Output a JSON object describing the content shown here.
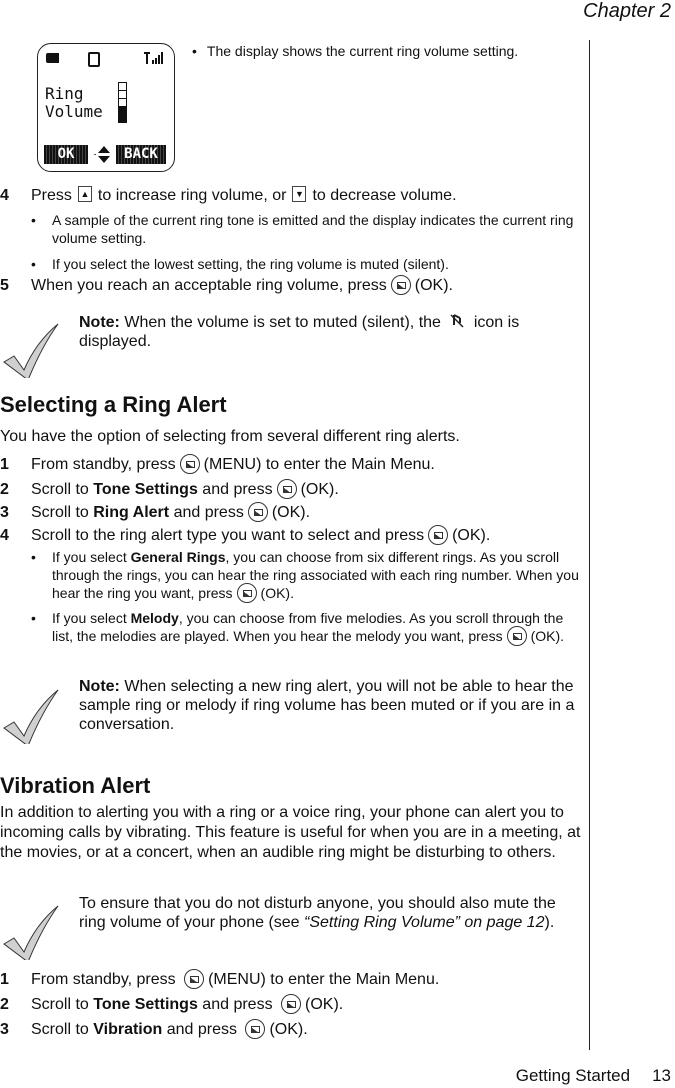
{
  "header": {
    "chapter": "Chapter 2"
  },
  "footer": {
    "section": "Getting Started",
    "page": "13"
  },
  "phone_display": {
    "label_line1": "Ring",
    "label_line2": "Volume",
    "volume_level": 2,
    "volume_max": 5,
    "softkey_left": "OK",
    "softkey_right": "BACK",
    "icons": [
      "battery-icon",
      "ringer-icon",
      "signal-strength-icon",
      "scroll-arrows-icon"
    ]
  },
  "intro_bullet": "The display shows the current ring volume setting.",
  "volume_steps": [
    {
      "num": "4",
      "pre": "Press",
      "mid": "to increase ring volume, or",
      "post": "to decrease volume."
    },
    {
      "num": "5",
      "pre": "When you reach an acceptable ring volume, press",
      "post": "(OK)."
    }
  ],
  "volume_bullets": [
    "A sample of the current ring tone is emitted and the display indicates the current ring volume setting.",
    "If you select the lowest setting, the ring volume is muted (silent)."
  ],
  "note1": {
    "label": "Note:",
    "pre": "When the volume is set to muted (silent), the",
    "post": "icon is displayed."
  },
  "ring_alert": {
    "title": "Selecting a Ring Alert",
    "intro": "You have the option of selecting from several different ring alerts.",
    "steps": [
      {
        "num": "1",
        "pre": "From standby, press",
        "post": "(MENU) to enter the Main Menu."
      },
      {
        "num": "2",
        "pre": "Scroll to",
        "bold": "Tone Settings",
        "mid": "and press",
        "post": "(OK)."
      },
      {
        "num": "3",
        "pre": "Scroll to",
        "bold": "Ring Alert",
        "mid": "and press",
        "post": "(OK)."
      },
      {
        "num": "4",
        "pre": "Scroll to the ring alert type you want to select and press",
        "post": "(OK)."
      }
    ],
    "bullets": [
      {
        "pre": "If you select",
        "bold": "General Rings",
        "text": ", you can choose from six different rings. As you scroll through the rings, you can hear the ring associated with each ring number. When you hear the ring you want, press",
        "post": "(OK)."
      },
      {
        "pre": "If you select",
        "bold": "Melody",
        "text": ", you can choose from five melodies. As you scroll through the list, the melodies are played. When you hear the melody you want, press",
        "post": "(OK)."
      }
    ],
    "note": {
      "label": "Note:",
      "text": "When selecting a new ring alert, you will not be able to hear the sample ring or melody if ring volume has been muted or if you are in a conversation."
    }
  },
  "vibration": {
    "title": "Vibration Alert",
    "intro": "In addition to alerting you with a ring or a voice ring, your phone can alert you to incoming calls by vibrating. This feature is useful for when you are in a meeting, at the movies, or at a concert, when an audible ring might be disturbing to others.",
    "note": {
      "pre": "To ensure that you do not disturb anyone, you should also mute the ring volume of your phone (see",
      "ref": "“Setting Ring Volume” on page 12",
      "post": ")."
    },
    "steps": [
      {
        "num": "1",
        "pre": "From standby, press",
        "post": "(MENU) to enter the Main Menu."
      },
      {
        "num": "2",
        "pre": "Scroll to",
        "bold": "Tone Settings",
        "mid": "and press",
        "post": "(OK)."
      },
      {
        "num": "3",
        "pre": "Scroll to",
        "bold": "Vibration",
        "mid": "and press",
        "post": "(OK)."
      }
    ]
  }
}
